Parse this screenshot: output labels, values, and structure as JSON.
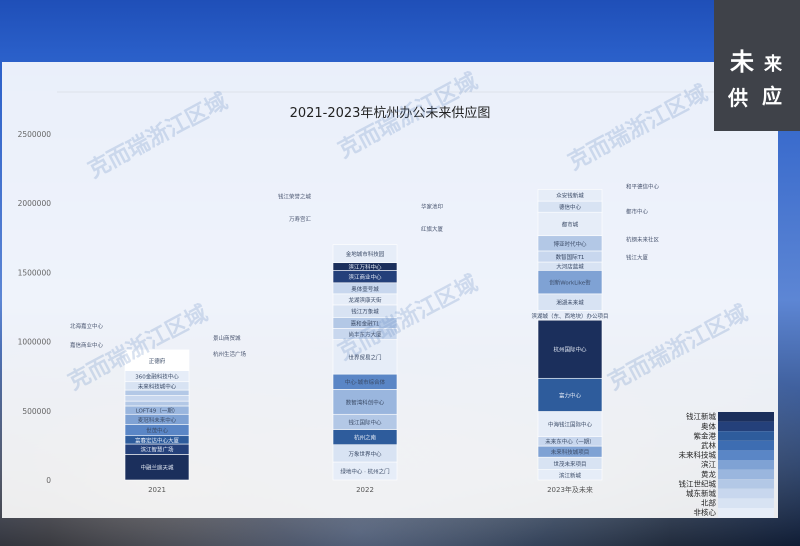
{
  "corner_label": {
    "c1": "未",
    "c2": "来",
    "c3": "供",
    "c4": "应"
  },
  "watermark": "克而瑞浙江区域",
  "colors": {
    "background": "#2a5fc9",
    "panel": "#ffffff"
  },
  "chart_data": {
    "type": "bar",
    "stacked": true,
    "title": "2021-2023年杭州办公未来供应图",
    "xlabel": "",
    "ylabel": "",
    "ylim": [
      0,
      2500000
    ],
    "yticks": [
      0,
      500000,
      1000000,
      1500000,
      2000000,
      2500000
    ],
    "ytick_labels": [
      "0",
      "500000",
      "1000000",
      "1500000",
      "2000000",
      "2500000"
    ],
    "grid": false,
    "legend_position": "bottom-right",
    "categories": [
      "2021",
      "2022",
      "2023年及未来"
    ],
    "legend": [
      {
        "name": "钱江新城",
        "color": "#1b2f5c"
      },
      {
        "name": "奥体",
        "color": "#24407a"
      },
      {
        "name": "紫金港",
        "color": "#2e5c9c"
      },
      {
        "name": "武林",
        "color": "#3d6db2"
      },
      {
        "name": "未来科技城",
        "color": "#5a86c6"
      },
      {
        "name": "滨江",
        "color": "#7fa2d4"
      },
      {
        "name": "黄龙",
        "color": "#9ab6de"
      },
      {
        "name": "钱江世纪城",
        "color": "#b3c8e6"
      },
      {
        "name": "城东新城",
        "color": "#c8d7ee"
      },
      {
        "name": "北部",
        "color": "#d8e3f3"
      },
      {
        "name": "非核心",
        "color": "#e6edf8"
      }
    ],
    "bars": [
      {
        "category": "2021",
        "segments": [
          {
            "label": "中融兰庭天城",
            "value": 185000,
            "color": "#1b2f5c"
          },
          {
            "label": "滨江智慧广场",
            "value": 75000,
            "color": "#24407a"
          },
          {
            "label": "富春宏达中心大厦",
            "value": 60000,
            "color": "#2e5c9c"
          },
          {
            "label": "世茂中心",
            "value": 80000,
            "color": "#5a86c6"
          },
          {
            "label": "麦冠科未来中心",
            "value": 75000,
            "color": "#7fa2d4"
          },
          {
            "label": "LOFT49（一期）",
            "value": 60000,
            "color": "#9ab6de"
          },
          {
            "label": "紫金港",
            "value": 35000,
            "color": "#b3c8e6"
          },
          {
            "label": "杭州云栖小镇办公",
            "value": 40000,
            "color": "#c8d7ee"
          },
          {
            "label": "美国际金融中心",
            "value": 40000,
            "color": "#b3c8e6"
          },
          {
            "label": "未来科技城中心",
            "value": 60000,
            "color": "#d8e3f3"
          },
          {
            "label": "360金融科技中心",
            "value": 80000,
            "color": "#e6edf8"
          },
          {
            "label": "正德府",
            "value": 150000,
            "color": "#ffffff"
          }
        ],
        "side_labels": [
          {
            "text": "北海嘉立中心",
            "side": "left"
          },
          {
            "text": "嘉信商业中心",
            "side": "left"
          },
          {
            "text": "景山商贸城",
            "side": "right"
          },
          {
            "text": "杭州生活广场",
            "side": "right"
          }
        ]
      },
      {
        "category": "2022",
        "segments": [
          {
            "label": "绿地中心 · 杭州之门",
            "value": 130000,
            "color": "#e6edf8"
          },
          {
            "label": "万象世界中心",
            "value": 125000,
            "color": "#d8e3f3"
          },
          {
            "label": "杭州之南",
            "value": 110000,
            "color": "#2e5c9c"
          },
          {
            "label": "钱江国际中心",
            "value": 110000,
            "color": "#b3c8e6"
          },
          {
            "label": "数智湾科创中心",
            "value": 180000,
            "color": "#9ab6de"
          },
          {
            "label": "中心·城市综合体",
            "value": 110000,
            "color": "#5a86c6"
          },
          {
            "label": "世界贸易之门",
            "value": 250000,
            "color": "#e6edf8"
          },
          {
            "label": "尚丰东方大厦",
            "value": 80000,
            "color": "#c8d7ee"
          },
          {
            "label": "嘉和金融T1",
            "value": 80000,
            "color": "#b3c8e6"
          },
          {
            "label": "钱江万象城",
            "value": 90000,
            "color": "#d8e3f3"
          },
          {
            "label": "龙湖滨康天街",
            "value": 80000,
            "color": "#e6edf8"
          },
          {
            "label": "奥体壹号城",
            "value": 80000,
            "color": "#c8d7ee"
          },
          {
            "label": "滨江商业中心",
            "value": 90000,
            "color": "#24407a"
          },
          {
            "label": "滨江万科中心",
            "value": 55000,
            "color": "#1b2f5c"
          },
          {
            "label": "金地城市科技园",
            "value": 130000,
            "color": "#e6edf8"
          }
        ],
        "side_labels": [
          {
            "text": "钱江荣誉之城",
            "side": "left"
          },
          {
            "text": "万寿宫汇",
            "side": "left"
          },
          {
            "text": "华家池印",
            "side": "right"
          },
          {
            "text": "红旗大厦",
            "side": "right"
          }
        ]
      },
      {
        "category": "2023年及未来",
        "segments": [
          {
            "label": "滨江新城",
            "value": 75000,
            "color": "#e6edf8"
          },
          {
            "label": "世茂未来项目",
            "value": 90000,
            "color": "#d8e3f3"
          },
          {
            "label": "未来科技城项目",
            "value": 80000,
            "color": "#7fa2d4"
          },
          {
            "label": "未来东中心（一期）",
            "value": 70000,
            "color": "#c8d7ee"
          },
          {
            "label": "中海钱江国际中心",
            "value": 180000,
            "color": "#e6edf8"
          },
          {
            "label": "富力中心",
            "value": 240000,
            "color": "#2e5c9c"
          },
          {
            "label": "杭州国际中心",
            "value": 420000,
            "color": "#1b2f5c"
          },
          {
            "label": "滨湖城（东、西地块）办公项目",
            "value": 70000,
            "color": "#e6edf8"
          },
          {
            "label": "湘湖未来城",
            "value": 120000,
            "color": "#d8e3f3"
          },
          {
            "label": "创新WorkLike街",
            "value": 170000,
            "color": "#7fa2d4"
          },
          {
            "label": "大河店蓝城",
            "value": 60000,
            "color": "#d8e3f3"
          },
          {
            "label": "数智国际T1",
            "value": 80000,
            "color": "#c8d7ee"
          },
          {
            "label": "博亚时代中心",
            "value": 110000,
            "color": "#b3c8e6"
          },
          {
            "label": "都市城",
            "value": 170000,
            "color": "#e6edf8"
          },
          {
            "label": "德信中心",
            "value": 80000,
            "color": "#d8e3f3"
          },
          {
            "label": "众安钱新城",
            "value": 85000,
            "color": "#e6edf8"
          }
        ],
        "side_labels": [
          {
            "text": "和平德信中心",
            "side": "right"
          },
          {
            "text": "都市中心",
            "side": "right"
          },
          {
            "text": "杭钢未来社区",
            "side": "right"
          },
          {
            "text": "钱江大厦",
            "side": "right"
          }
        ]
      }
    ]
  }
}
